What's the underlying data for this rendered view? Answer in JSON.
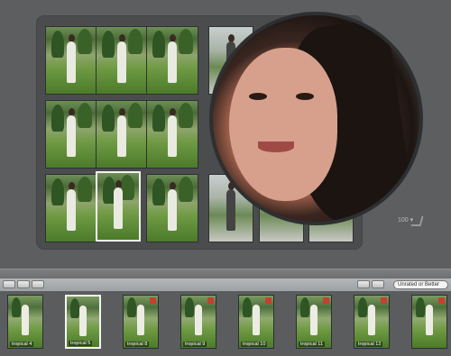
{
  "stack": {
    "rows": 3,
    "cols": 3,
    "selected_index": 7,
    "extra_column": [
      "dim",
      "dim",
      "dim"
    ]
  },
  "loupe": {
    "zoom_label": "100 ▾"
  },
  "toolbar": {
    "filter_text": "Unrated or Better"
  },
  "filmstrip": {
    "thumbnails": [
      {
        "label": "tropical 4",
        "badge": false
      },
      {
        "label": "tropical 5",
        "badge": false,
        "selected": true
      },
      {
        "label": "tropical 8",
        "badge": true
      },
      {
        "label": "tropical 9",
        "badge": true
      },
      {
        "label": "tropical 10",
        "badge": true
      },
      {
        "label": "tropical 11",
        "badge": true
      },
      {
        "label": "tropical 12",
        "badge": true
      }
    ]
  },
  "colors": {
    "background": "#5e6062",
    "selection_border": "#f2f2f2",
    "badge": "#c6402f"
  }
}
